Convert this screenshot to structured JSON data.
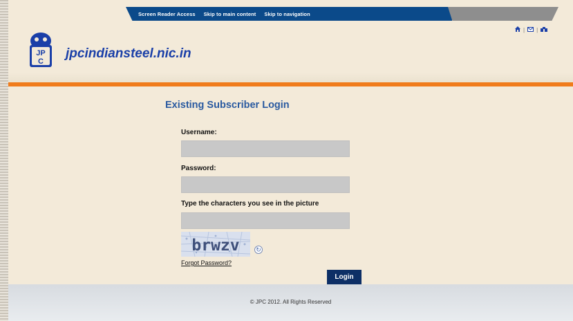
{
  "topnav": {
    "links": [
      "Screen Reader Access",
      "Skip to main content",
      "Skip to navigation"
    ]
  },
  "header": {
    "site_name": "jpcindiansteel.nic.in",
    "logo_text": "JPC",
    "icons": [
      "home-icon",
      "mail-icon",
      "sitemap-icon"
    ]
  },
  "login": {
    "title": "Existing Subscriber Login",
    "username_label": "Username:",
    "username_value": "",
    "password_label": "Password:",
    "password_value": "",
    "captcha_label": "Type the characters you see in the picture",
    "captcha_value": "",
    "captcha_text": "brwzv",
    "forgot_label": "Forgot Password?",
    "login_button": "Login"
  },
  "footer": {
    "copyright": "© JPC 2012. All Rights Reserved"
  },
  "colors": {
    "nav_blue": "#0b4a8a",
    "accent_orange": "#f07c1c",
    "title_blue": "#2a5aa0",
    "button_navy": "#0d2f66"
  }
}
